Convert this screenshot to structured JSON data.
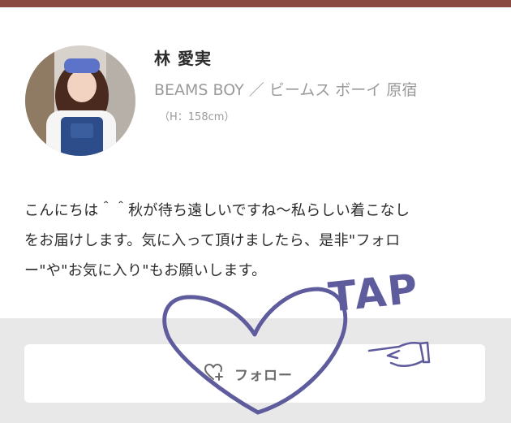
{
  "profile": {
    "name": "林 愛実",
    "shop": "BEAMS BOY ／ ビームス ボーイ 原宿",
    "height": "（H：158cm）"
  },
  "bio": {
    "lines": [
      "こんにちは＾＾秋が待ち遠しいですね〜私らしい着こなし",
      "をお届けします。気に入って頂けましたら、是非\"フォロ",
      "ー\"や\"お気に入り\"もお願いします。"
    ]
  },
  "follow_button": {
    "label": "フォロー",
    "icon": "heart-plus-icon"
  },
  "annotation": {
    "text": "TAP",
    "color": "#5f5c9e",
    "pointer_icon": "pointing-hand-icon"
  },
  "colors": {
    "top_bar": "#8a4a42",
    "footer_bg": "#e8e8e8",
    "annotation": "#5f5c9e"
  }
}
